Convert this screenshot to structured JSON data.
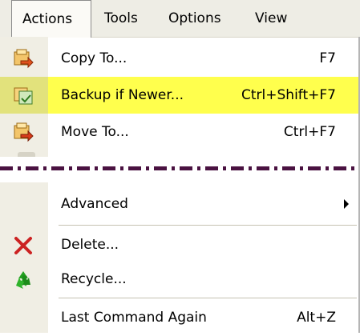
{
  "menubar": {
    "items": [
      {
        "label": "Actions",
        "active": true
      },
      {
        "label": "Tools"
      },
      {
        "label": "Options"
      },
      {
        "label": "View"
      }
    ]
  },
  "menu": {
    "items": [
      {
        "label": "Copy To...",
        "shortcut": "F7",
        "icon": "copy-to-icon"
      },
      {
        "label": "Backup if Newer...",
        "shortcut": "Ctrl+Shift+F7",
        "icon": "backup-icon",
        "highlighted": true
      },
      {
        "label": "Move To...",
        "shortcut": "Ctrl+F7",
        "icon": "move-to-icon"
      },
      {
        "label": "Advanced",
        "submenu": true
      },
      {
        "label": "Delete...",
        "icon": "delete-icon"
      },
      {
        "label": "Recycle...",
        "icon": "recycle-icon"
      },
      {
        "label": "Last Command Again",
        "shortcut": "Alt+Z"
      }
    ]
  },
  "colors": {
    "highlight": "#ffff4d",
    "dashed_divider": "#4a1241",
    "delete": "#cc2222",
    "recycle": "#22a020"
  }
}
